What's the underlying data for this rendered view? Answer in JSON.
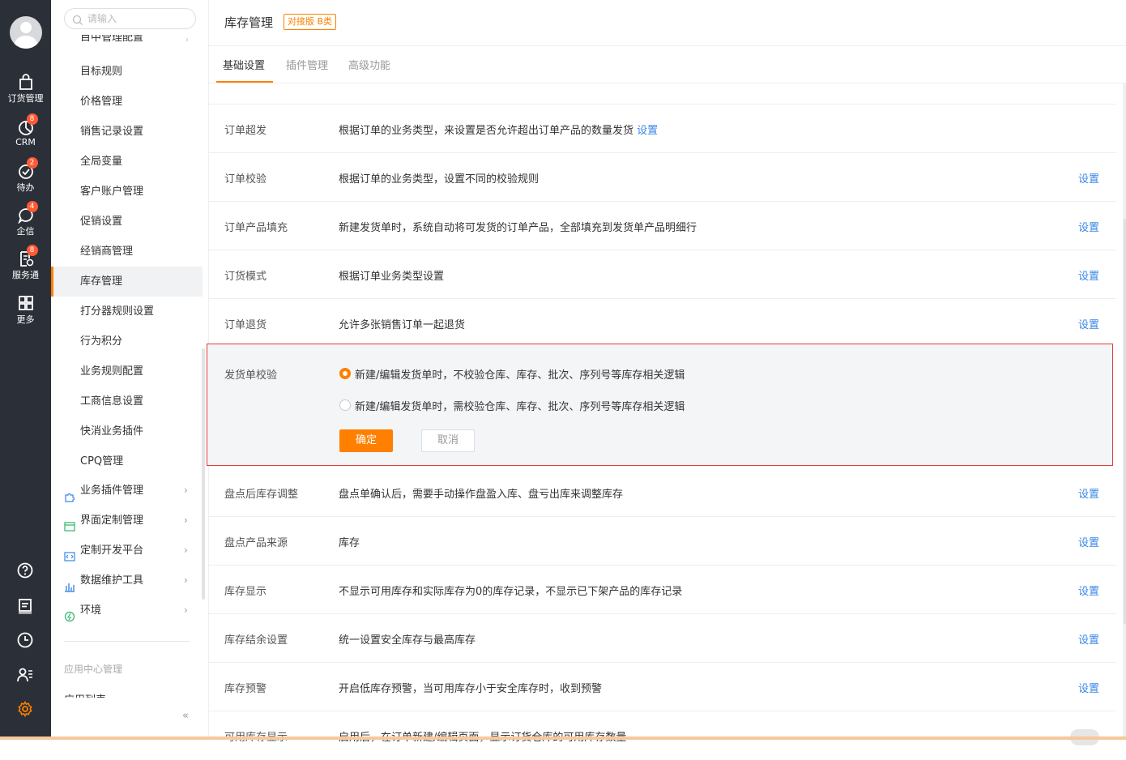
{
  "rail": {
    "items": [
      {
        "label": "订货管理",
        "icon": "bag-icon",
        "badge": ""
      },
      {
        "label": "CRM",
        "icon": "pie-chart-icon",
        "badge": "8"
      },
      {
        "label": "待办",
        "icon": "check-circle-icon",
        "badge": "2"
      },
      {
        "label": "企信",
        "icon": "chat-bubble-icon",
        "badge": "4"
      },
      {
        "label": "服务通",
        "icon": "service-doc-icon",
        "badge": "8"
      },
      {
        "label": "更多",
        "icon": "grid-icon",
        "badge": ""
      }
    ],
    "bottom_icons": [
      "help-icon",
      "notebook-icon",
      "clock-icon",
      "user-list-icon",
      "settings-gear-icon"
    ],
    "accent": "#ff8000"
  },
  "subnav": {
    "search_placeholder": "请输入",
    "cut_top_item": "目中管理配置",
    "items": [
      "目标规则",
      "价格管理",
      "销售记录设置",
      "全局变量",
      "客户账户管理",
      "促销设置",
      "经销商管理",
      "库存管理",
      "打分器规则设置",
      "行为积分",
      "业务规则配置",
      "工商信息设置",
      "快消业务插件",
      "CPQ管理"
    ],
    "active_item": "库存管理",
    "groups": [
      {
        "label": "业务插件管理",
        "icon": "plugin-icon"
      },
      {
        "label": "界面定制管理",
        "icon": "layout-icon"
      },
      {
        "label": "定制开发平台",
        "icon": "code-icon"
      },
      {
        "label": "数据维护工具",
        "icon": "bar-chart-icon"
      },
      {
        "label": "环境",
        "icon": "environment-icon"
      }
    ],
    "section_label": "应用中心管理",
    "cut_bottom_item": "应用列表",
    "collapse_label": "«"
  },
  "header": {
    "title": "库存管理",
    "tag": "对接版 B类"
  },
  "tabs": [
    {
      "label": "基础设置",
      "active": true
    },
    {
      "label": "插件管理",
      "active": false
    },
    {
      "label": "高级功能",
      "active": false
    }
  ],
  "settings_top": [
    {
      "label": "订单超发",
      "desc": "根据订单的业务类型，来设置是否允许超出订单产品的数量发货",
      "inline_link": "设置",
      "action": ""
    },
    {
      "label": "订单校验",
      "desc": "根据订单的业务类型，设置不同的校验规则",
      "inline_link": "",
      "action": "设置"
    },
    {
      "label": "订单产品填充",
      "desc": "新建发货单时，系统自动将可发货的订单产品，全部填充到发货单产品明细行",
      "inline_link": "",
      "action": "设置"
    },
    {
      "label": "订货模式",
      "desc": "根据订单业务类型设置",
      "inline_link": "",
      "action": "设置"
    },
    {
      "label": "订单退货",
      "desc": "允许多张销售订单一起退货",
      "inline_link": "",
      "action": "设置"
    }
  ],
  "edit_panel": {
    "label": "发货单校验",
    "options": [
      {
        "text": "新建/编辑发货单时，不校验仓库、库存、批次、序列号等库存相关逻辑",
        "selected": true
      },
      {
        "text": "新建/编辑发货单时，需校验仓库、库存、批次、序列号等库存相关逻辑",
        "selected": false
      }
    ],
    "confirm": "确定",
    "cancel": "取消"
  },
  "settings_bottom": [
    {
      "label": "盘点后库存调整",
      "desc": "盘点单确认后，需要手动操作盘盈入库、盘亏出库来调整库存",
      "action": "设置"
    },
    {
      "label": "盘点产品来源",
      "desc": "库存",
      "action": "设置"
    },
    {
      "label": "库存显示",
      "desc": "不显示可用库存和实际库存为0的库存记录，不显示已下架产品的库存记录",
      "action": "设置"
    },
    {
      "label": "库存结余设置",
      "desc": "统一设置安全库存与最高库存",
      "action": "设置"
    },
    {
      "label": "库存预警",
      "desc": "开启低库存预警，当可用库存小于安全库存时，收到预警",
      "action": "设置"
    }
  ],
  "cut_row": {
    "label": "可用库存显示",
    "desc": "启用后，在订单新建/编辑页面，显示订货仓库的可用库存数量",
    "toggle_on": false
  }
}
